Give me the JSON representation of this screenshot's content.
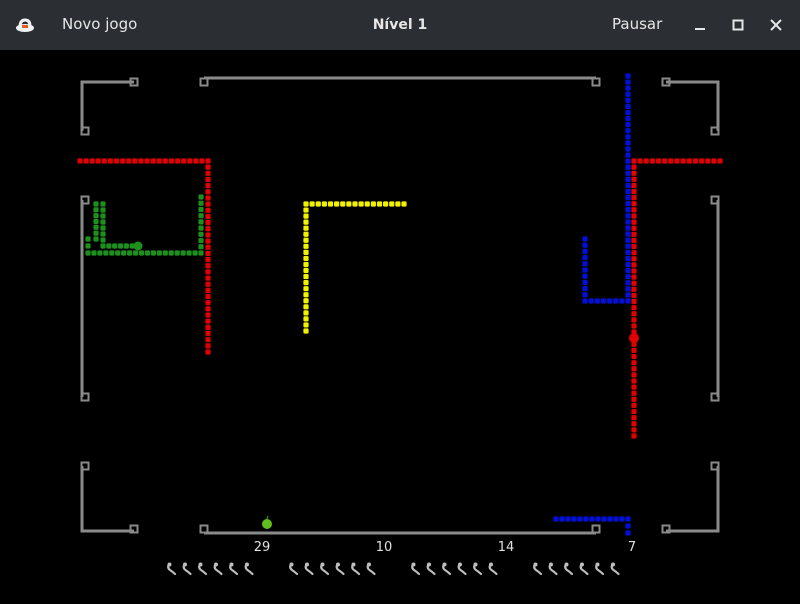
{
  "titlebar": {
    "app_icon": "snake-app-icon",
    "new_game_label": "Novo jogo",
    "title": "Nível 1",
    "pause_label": "Pausar",
    "window_buttons": [
      "minimize-icon",
      "maximize-icon",
      "close-icon"
    ]
  },
  "colors": {
    "titlebar_bg": "#2b2e33",
    "board_bg": "#000000",
    "wall": "#8a8a8a",
    "snake_red": "#e00000",
    "snake_green": "#1c8f1c",
    "snake_yellow": "#f2f200",
    "snake_blue": "#0010d8",
    "apple": "#5fbf1f"
  },
  "players": [
    {
      "color": "red",
      "score": "29",
      "lives": 6
    },
    {
      "color": "green",
      "score": "10",
      "lives": 6
    },
    {
      "color": "yellow",
      "score": "14",
      "lives": 6
    },
    {
      "color": "blue",
      "score": "7",
      "lives": 6
    }
  ],
  "items": [
    "apple"
  ]
}
